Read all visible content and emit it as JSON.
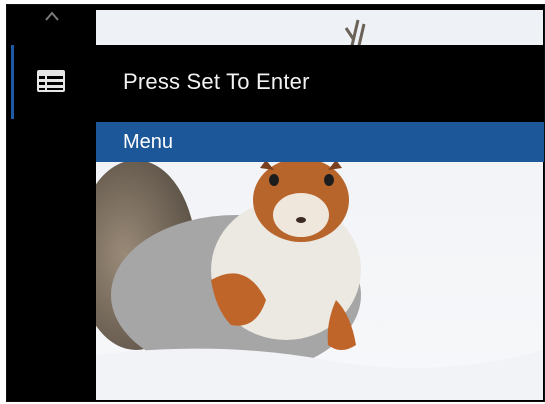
{
  "banner": {
    "text": "Press Set To Enter"
  },
  "menu": {
    "selected_label": "Menu"
  },
  "icons": {
    "side_icon": "menu-list-icon",
    "nav_icon": "chevron-up-icon"
  },
  "colors": {
    "highlight": "#1b5799",
    "accent": "#1e5aa8",
    "background": "#000000"
  }
}
